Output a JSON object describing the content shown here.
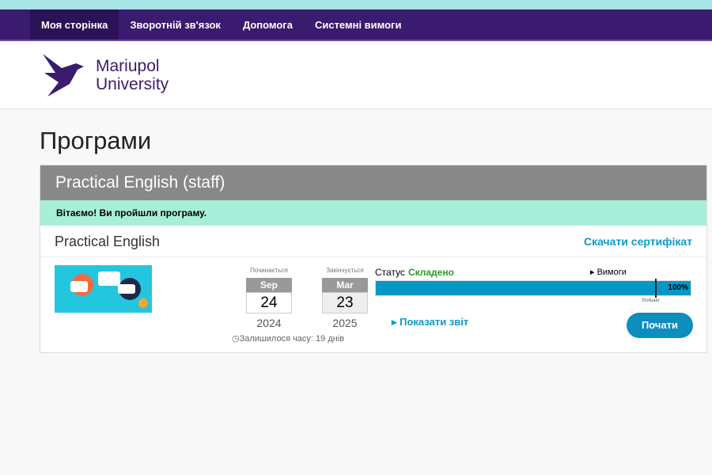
{
  "nav": {
    "items": [
      {
        "label": "Моя сторінка"
      },
      {
        "label": "Зворотній зв'язок"
      },
      {
        "label": "Допомога"
      },
      {
        "label": "Системні вимоги"
      }
    ]
  },
  "brand": {
    "line1": "Mariupol",
    "line2": "University"
  },
  "page_title": "Програми",
  "program": {
    "title": "Practical English (staff)",
    "congrats": "Вітаємо! Ви пройшли програму.",
    "course_name": "Practical English",
    "certificate_link": "Скачати сертифікат",
    "start": {
      "label": "Починається",
      "month": "Sep",
      "day": "24",
      "year": "2024"
    },
    "end": {
      "label": "Закінчується",
      "month": "Mar",
      "day": "23",
      "year": "2025"
    },
    "time_left": "Залишилося часу: 19 днів",
    "status_label": "Статус",
    "status_value": "Складено",
    "requirements": "▸ Вимоги",
    "progress_percent": 100,
    "progress_label": "100%",
    "progress_marker_label": "Успішно",
    "show_report": "▸ Показати звіт",
    "start_button": "Почати"
  },
  "colors": {
    "nav": "#3a1b6f",
    "accent": "#0e9ac7",
    "success": "#2a9a2a",
    "congrats_bg": "#a8efd9"
  }
}
